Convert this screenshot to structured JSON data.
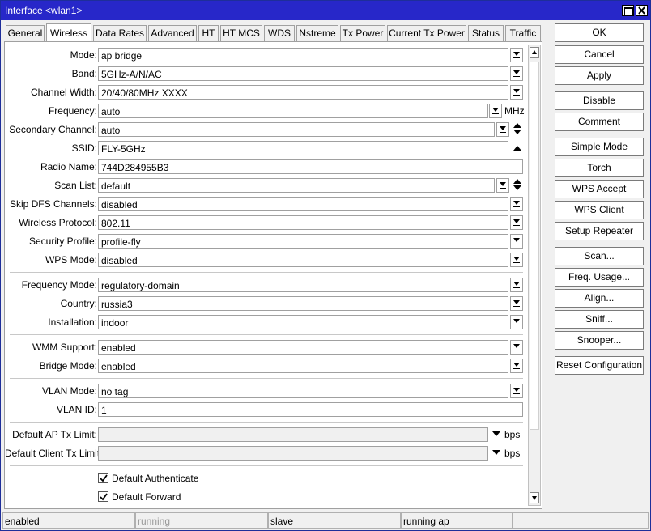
{
  "window": {
    "title": "Interface <wlan1>"
  },
  "tabs": [
    "General",
    "Wireless",
    "Data Rates",
    "Advanced",
    "HT",
    "HT MCS",
    "WDS",
    "Nstreme",
    "Tx Power",
    "Current Tx Power",
    "Status",
    "Traffic"
  ],
  "active_tab": "Wireless",
  "form": {
    "mode": {
      "label": "Mode:",
      "value": "ap bridge"
    },
    "band": {
      "label": "Band:",
      "value": "5GHz-A/N/AC"
    },
    "channel_width": {
      "label": "Channel Width:",
      "value": "20/40/80MHz XXXX"
    },
    "frequency": {
      "label": "Frequency:",
      "value": "auto",
      "unit": "MHz"
    },
    "secondary_channel": {
      "label": "Secondary Channel:",
      "value": "auto"
    },
    "ssid": {
      "label": "SSID:",
      "value": "FLY-5GHz"
    },
    "radio_name": {
      "label": "Radio Name:",
      "value": "744D284955B3"
    },
    "scan_list": {
      "label": "Scan List:",
      "value": "default"
    },
    "skip_dfs": {
      "label": "Skip DFS Channels:",
      "value": "disabled"
    },
    "wireless_protocol": {
      "label": "Wireless Protocol:",
      "value": "802.11"
    },
    "security_profile": {
      "label": "Security Profile:",
      "value": "profile-fly"
    },
    "wps_mode": {
      "label": "WPS Mode:",
      "value": "disabled"
    },
    "frequency_mode": {
      "label": "Frequency Mode:",
      "value": "regulatory-domain"
    },
    "country": {
      "label": "Country:",
      "value": "russia3"
    },
    "installation": {
      "label": "Installation:",
      "value": "indoor"
    },
    "wmm_support": {
      "label": "WMM Support:",
      "value": "enabled"
    },
    "bridge_mode": {
      "label": "Bridge Mode:",
      "value": "enabled"
    },
    "vlan_mode": {
      "label": "VLAN Mode:",
      "value": "no tag"
    },
    "vlan_id": {
      "label": "VLAN ID:",
      "value": "1"
    },
    "default_ap_tx_limit": {
      "label": "Default AP Tx Limit:",
      "value": "",
      "unit": "bps"
    },
    "default_client_tx_limit": {
      "label": "Default Client Tx Limit:",
      "value": "",
      "unit": "bps"
    },
    "default_authenticate": {
      "label": "Default Authenticate",
      "checked": true
    },
    "default_forward": {
      "label": "Default Forward",
      "checked": true
    }
  },
  "buttons": [
    "OK",
    "Cancel",
    "Apply",
    "Disable",
    "Comment",
    "Simple Mode",
    "Torch",
    "WPS Accept",
    "WPS Client",
    "Setup Repeater",
    "Scan...",
    "Freq. Usage...",
    "Align...",
    "Sniff...",
    "Snooper...",
    "Reset Configuration"
  ],
  "status": [
    "enabled",
    "running",
    "slave",
    "running ap",
    ""
  ]
}
